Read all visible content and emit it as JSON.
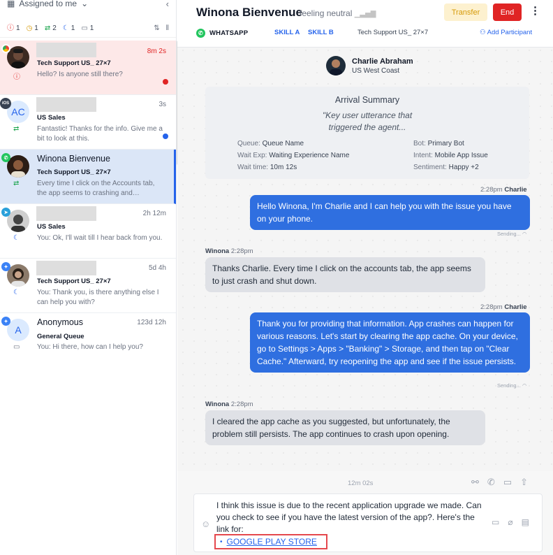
{
  "sidebar": {
    "assigned_label": "Assigned to me",
    "filters": [
      {
        "icon": "alert-circle-icon",
        "count": "1",
        "color": "#e02424"
      },
      {
        "icon": "clock-icon",
        "count": "1",
        "color": "#d69a08"
      },
      {
        "icon": "transfer-icon",
        "count": "2",
        "color": "#16a34a"
      },
      {
        "icon": "moon-icon",
        "count": "1",
        "color": "#2563eb"
      },
      {
        "icon": "chat-icon",
        "count": "1",
        "color": "#6b7280"
      }
    ],
    "conversations": [
      {
        "name": "",
        "time": "8m 2s",
        "queue": "Tech Support US_ 27×7",
        "message": "Hello? Is anyone still there?",
        "channel": "chrome",
        "status_icon": "alert-circle-icon"
      },
      {
        "name": "",
        "time": "3s",
        "queue": "US Sales",
        "message": "Fantastic! Thanks for the info. Give me a bit to look at this.",
        "channel": "ios",
        "avatar_initials": "AC",
        "channel_label": "iOS",
        "status_icon": "transfer-icon"
      },
      {
        "name": "Winona Bienvenue",
        "time": "",
        "queue": "Tech Support US_ 27×7",
        "message": "Every time I click on the Accounts tab, the app seems to crashing and…",
        "channel": "whatsapp",
        "status_icon": "transfer-icon"
      },
      {
        "name": "",
        "time": "2h 12m",
        "queue": "US Sales",
        "message": "You: Ok, I'll wait till I hear back from you.",
        "channel": "telegram",
        "status_icon": "moon-icon"
      },
      {
        "name": "",
        "time": "5d 4h",
        "queue": "Tech Support US_ 27×7",
        "message": "You: Thank you, is there anything else I can help you with?",
        "channel": "messenger",
        "status_icon": "moon-icon"
      },
      {
        "name": "Anonymous",
        "time": "123d 12h",
        "queue": "General Queue",
        "message": "You: Hi there, how can I help you?",
        "channel": "messenger",
        "avatar_initials": "A",
        "status_icon": "chat-icon"
      }
    ]
  },
  "header": {
    "customer_name": "Winona Bienvenue",
    "mood": "feeling neutral",
    "transfer_label": "Transfer",
    "end_label": "End",
    "channel": "WHATSAPP",
    "skill_a": "SKILL A",
    "skill_b": "SKILL B",
    "team": "Tech Support US_ 27×7",
    "add_participant": "Add Participant"
  },
  "agent": {
    "name": "Charlie Abraham",
    "location": "US West Coast"
  },
  "summary": {
    "title": "Arrival Summary",
    "quote_line1": "\"Key user utterance that",
    "quote_line2": "triggered the agent...",
    "queue_label": "Queue:",
    "queue": "Queue Name",
    "wait_exp_label": "Wait Exp:",
    "wait_exp": "Waiting Experience Name",
    "wait_time_label": "Wait time:",
    "wait_time": "10m 12s",
    "bot_label": "Bot:",
    "bot": "Primary Bot",
    "intent_label": "Intent:",
    "intent": "Mobile App Issue",
    "sentiment_label": "Sentiment:",
    "sentiment": "Happy +2"
  },
  "messages": [
    {
      "time": "2:28pm",
      "sender": "Charlie",
      "text": "Hello Winona, I'm Charlie and I can help you with the issue you have on your phone.",
      "status": "Sending..."
    },
    {
      "time": "2:28pm",
      "sender": "Winona",
      "text": "Thanks Charlie. Every time I click on the accounts tab, the app seems to just crash and shut down."
    },
    {
      "time": "2:28pm",
      "sender": "Charlie",
      "text": "Thank you for providing that information. App crashes can happen for various reasons. Let's start by clearing the app cache. On your device, go to Settings > Apps > \"Banking\" > Storage, and then tap on \"Clear Cache.\" Afterward, try reopening the app and see if the issue persists.",
      "status": "Sending..."
    },
    {
      "time": "2:28pm",
      "sender": "Winona",
      "text": "I cleared the app cache as you suggested, but unfortunately, the problem still persists. The app continues to crash upon opening."
    }
  ],
  "composer": {
    "timer": "12m 02s",
    "text": "I think this issue is due to the recent application upgrade we made. Can you check to see if you have the latest version of the app?. Here's the link for:",
    "link_label": "GOOGLE PLAY STORE"
  }
}
